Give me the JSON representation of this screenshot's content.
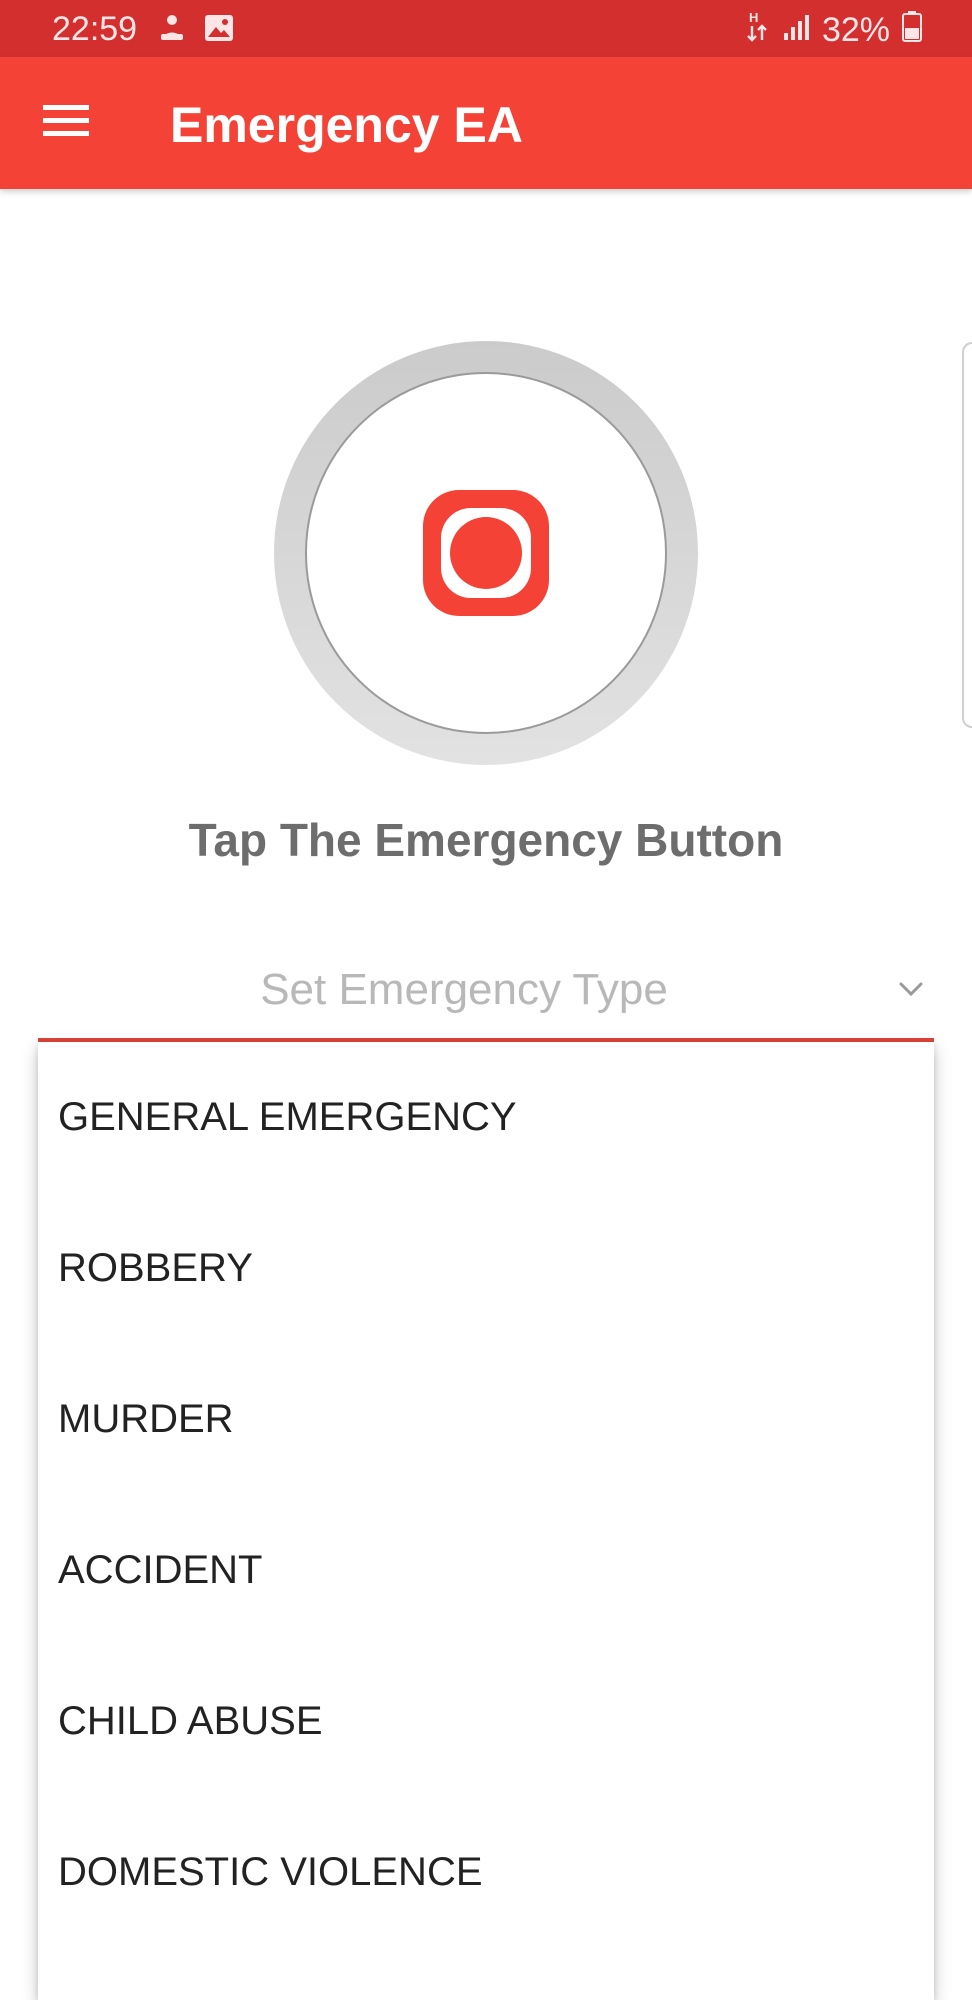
{
  "status_bar": {
    "time": "22:59",
    "battery": "32%",
    "icons": [
      "person-notification-icon",
      "image-notification-icon",
      "network-type-icon",
      "signal-icon",
      "battery-icon"
    ]
  },
  "app_bar": {
    "title": "Emergency EA",
    "menu_icon": "hamburger-menu-icon"
  },
  "colors": {
    "status_bar": "#d32f2f",
    "app_bar": "#f44336",
    "accent": "#f44336",
    "ring": "#d6d6d6",
    "prompt_text": "#6d6d6d"
  },
  "main": {
    "emergency_button_icon": "record-stop-icon",
    "prompt": "Tap The Emergency Button",
    "emergency_type": {
      "placeholder": "Set Emergency Type",
      "options": [
        "GENERAL EMERGENCY",
        "ROBBERY",
        "MURDER",
        "ACCIDENT",
        "CHILD ABUSE",
        "DOMESTIC VIOLENCE"
      ]
    }
  }
}
